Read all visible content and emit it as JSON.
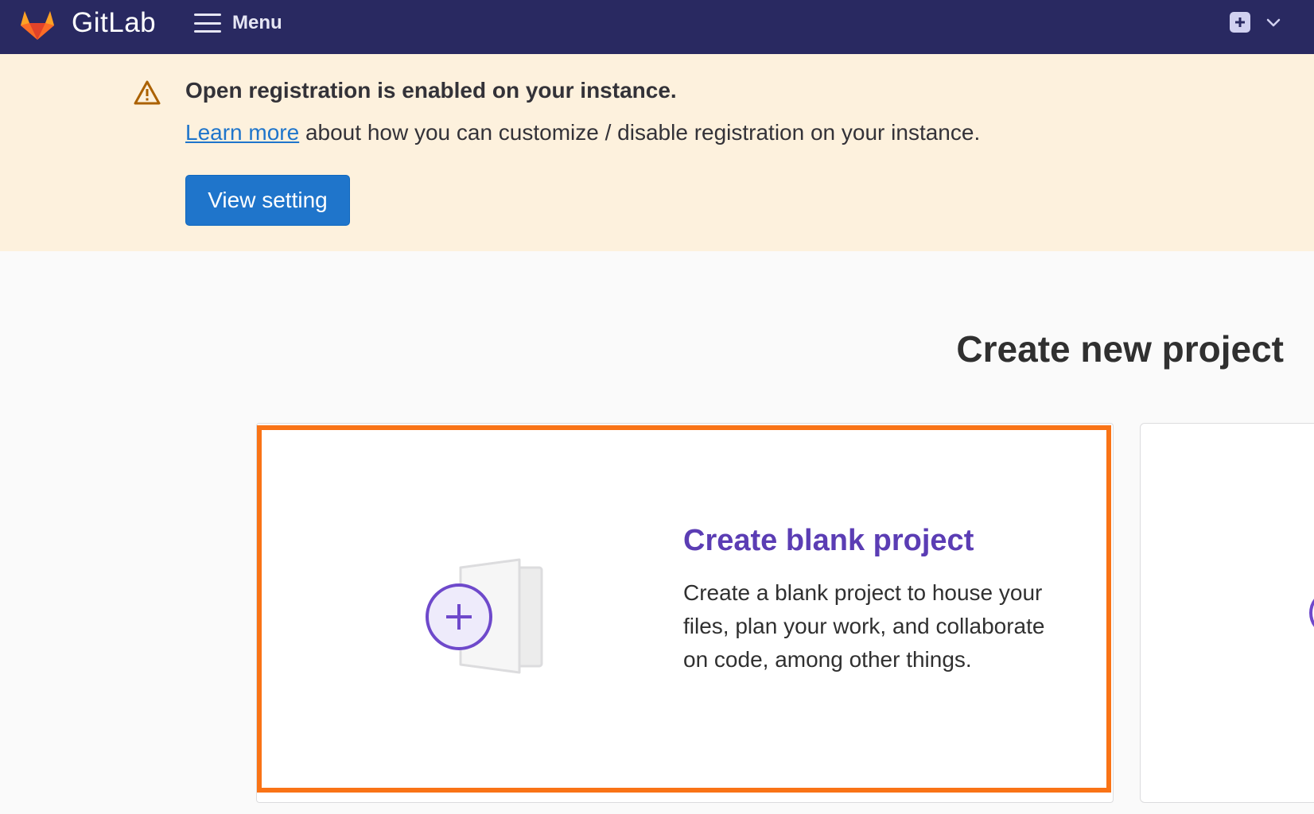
{
  "header": {
    "brand": "GitLab",
    "menu_label": "Menu",
    "colors": {
      "background": "#292961",
      "logo_orange": "#fc6d26"
    }
  },
  "banner": {
    "title": "Open registration is enabled on your instance.",
    "link_text": "Learn more",
    "body_text": " about how you can customize / disable registration on your instance.",
    "button_label": "View setting",
    "colors": {
      "background": "#fdf1dd",
      "button": "#1f75cb"
    }
  },
  "main": {
    "title": "Create new project",
    "cards": [
      {
        "title": "Create blank project",
        "description": "Create a blank project to house your files, plan your work, and collaborate on code, among other things."
      }
    ],
    "highlight_color": "#f97316",
    "card_title_color": "#5b3db4"
  }
}
